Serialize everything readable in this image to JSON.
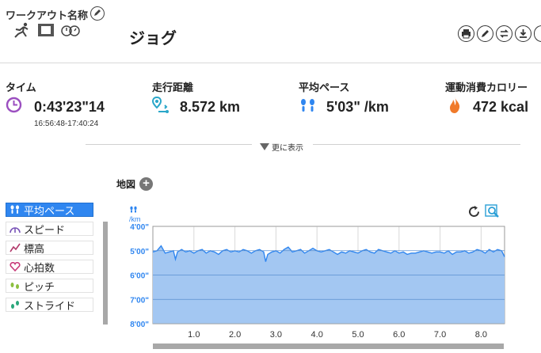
{
  "header": {
    "workout_label": "ワークアウト名称",
    "workout_name": "ジョグ"
  },
  "stats": {
    "time": {
      "label": "タイム",
      "value": "0:43'23\"14",
      "range": "16:56:48-17:40:24"
    },
    "distance": {
      "label": "走行距離",
      "value": "8.572 km"
    },
    "pace": {
      "label": "平均ペース",
      "value": "5'03\" /km"
    },
    "calories": {
      "label": "運動消費カロリー",
      "value": "472 kcal"
    }
  },
  "expand_label": "更に表示",
  "map_label": "地図",
  "metrics": [
    {
      "label": "平均ペース",
      "icon": "footprints-icon",
      "active": true
    },
    {
      "label": "スピード",
      "icon": "speedometer-icon",
      "active": false
    },
    {
      "label": "標高",
      "icon": "elevation-icon",
      "active": false
    },
    {
      "label": "心拍数",
      "icon": "heart-icon",
      "active": false
    },
    {
      "label": "ピッチ",
      "icon": "cadence-icon",
      "active": false
    },
    {
      "label": "ストライド",
      "icon": "stride-icon",
      "active": false
    }
  ],
  "colors": {
    "accent": "#2f86f0",
    "time_icon": "#9b4fc0",
    "pace_icon": "#2f86f0",
    "cal_icon": "#f07a2a",
    "chart_fill": "#a3c7f2",
    "chart_line": "#2f86f0"
  },
  "chart_data": {
    "type": "area",
    "ylabel_unit": "/km",
    "y_ticks": [
      "4'00\"",
      "5'00\"",
      "6'00\"",
      "7'00\"",
      "8'00\""
    ],
    "y_tick_values": [
      4,
      5,
      6,
      7,
      8
    ],
    "ylim": [
      4,
      8
    ],
    "y_inverted": true,
    "x_ticks": [
      "1.0",
      "2.0",
      "3.0",
      "4.0",
      "5.0",
      "6.0",
      "7.0",
      "8.0"
    ],
    "x_tick_values": [
      1,
      2,
      3,
      4,
      5,
      6,
      7,
      8
    ],
    "xlim": [
      0,
      8.572
    ],
    "grid": true,
    "x": [
      0,
      0.1,
      0.15,
      0.2,
      0.3,
      0.4,
      0.5,
      0.55,
      0.6,
      0.7,
      0.8,
      0.9,
      1.0,
      1.1,
      1.2,
      1.3,
      1.4,
      1.5,
      1.6,
      1.7,
      1.8,
      1.9,
      2.0,
      2.1,
      2.2,
      2.3,
      2.4,
      2.5,
      2.6,
      2.7,
      2.75,
      2.8,
      2.9,
      3.0,
      3.1,
      3.2,
      3.3,
      3.4,
      3.5,
      3.6,
      3.7,
      3.8,
      3.9,
      4.0,
      4.1,
      4.2,
      4.3,
      4.4,
      4.5,
      4.6,
      4.7,
      4.8,
      4.9,
      5.0,
      5.1,
      5.2,
      5.3,
      5.4,
      5.5,
      5.6,
      5.7,
      5.8,
      5.9,
      6.0,
      6.1,
      6.2,
      6.3,
      6.4,
      6.5,
      6.6,
      6.7,
      6.8,
      6.9,
      7.0,
      7.1,
      7.2,
      7.3,
      7.4,
      7.5,
      7.6,
      7.7,
      7.8,
      7.9,
      8.0,
      8.1,
      8.2,
      8.3,
      8.4,
      8.5,
      8.572
    ],
    "values": [
      5.05,
      5.0,
      4.9,
      4.8,
      5.1,
      5.05,
      5.0,
      5.35,
      5.05,
      4.95,
      5.05,
      5.0,
      5.1,
      5.0,
      4.95,
      5.1,
      5.0,
      5.05,
      5.15,
      5.0,
      4.95,
      5.05,
      5.0,
      5.05,
      4.95,
      5.0,
      5.1,
      5.0,
      4.95,
      5.05,
      5.45,
      5.15,
      5.05,
      5.0,
      5.1,
      4.95,
      4.85,
      5.05,
      5.0,
      4.95,
      5.1,
      5.0,
      4.9,
      5.0,
      5.05,
      5.0,
      4.95,
      5.05,
      5.15,
      5.05,
      5.1,
      5.0,
      5.05,
      5.1,
      5.0,
      4.95,
      5.05,
      5.1,
      4.95,
      5.0,
      5.05,
      5.1,
      5.0,
      5.1,
      5.05,
      5.15,
      5.1,
      5.1,
      5.05,
      5.0,
      5.05,
      5.1,
      5.05,
      5.05,
      5.1,
      5.0,
      5.15,
      5.05,
      5.05,
      5.0,
      5.1,
      5.05,
      4.95,
      5.0,
      5.1,
      4.95,
      5.05,
      4.95,
      5.0,
      5.25
    ]
  }
}
